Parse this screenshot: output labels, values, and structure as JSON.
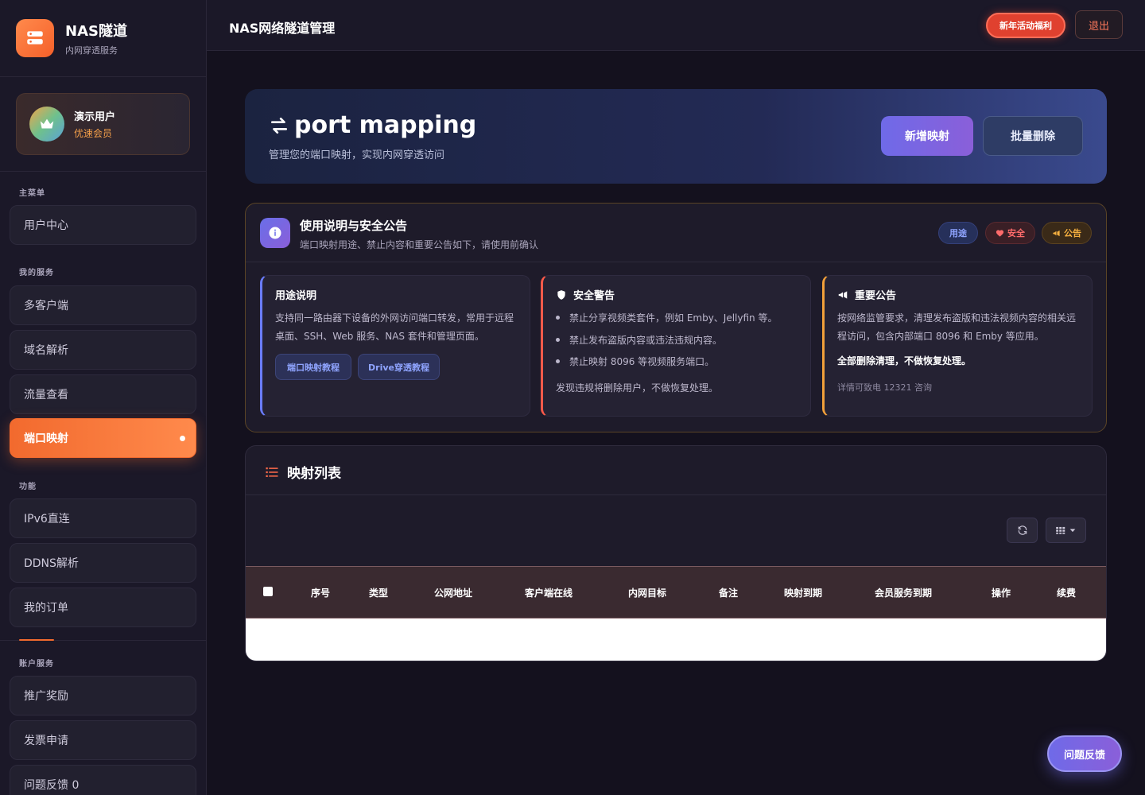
{
  "brand": {
    "title": "NAS隧道",
    "subtitle": "内网穿透服务"
  },
  "user": {
    "name": "演示用户",
    "level": "优速会员"
  },
  "sidebar": {
    "sections": {
      "main": "主菜单",
      "services": "我的服务",
      "features": "功能",
      "account": "账户服务"
    },
    "items": {
      "user_center": "用户中心",
      "multi_client": "多客户端",
      "domain": "域名解析",
      "traffic": "流量查看",
      "port_mapping": "端口映射",
      "ipv6": "IPv6直连",
      "ddns": "DDNS解析",
      "orders": "我的订单",
      "referral": "推广奖励",
      "invoice": "发票申请",
      "feedback": "问题反馈 0"
    }
  },
  "topbar": {
    "title": "NAS网络隧道管理",
    "promo": "新年活动福利",
    "logout": "退出"
  },
  "hero": {
    "title": "port mapping",
    "subtitle": "管理您的端口映射，实现内网穿透访问",
    "add_button": "新增映射",
    "delete_button": "批量删除"
  },
  "notice": {
    "title": "使用说明与安全公告",
    "subtitle": "端口映射用途、禁止内容和重要公告如下，请使用前确认",
    "tags": {
      "use": "用途",
      "safe": "安全",
      "announce": "公告"
    },
    "usage": {
      "title": "用途说明",
      "text": "支持同一路由器下设备的外网访问端口转发，常用于远程桌面、SSH、Web 服务、NAS 套件和管理页面。",
      "link1": "端口映射教程",
      "link2": "Drive穿透教程"
    },
    "security": {
      "title": "安全警告",
      "bullets": [
        "禁止分享视频类套件，例如 Emby、Jellyfin 等。",
        "禁止发布盗版内容或违法违规内容。",
        "禁止映射 8096 等视频服务端口。"
      ],
      "footer": "发现违规将删除用户，不做恢复处理。"
    },
    "announcement": {
      "title": "重要公告",
      "text": "按网络监管要求，清理发布盗版和违法视频内容的相关远程访问，包含内部端口 8096 和 Emby 等应用。",
      "strong": "全部删除清理，不做恢复处理。",
      "footer": "详情可致电 12321 咨询"
    }
  },
  "list": {
    "title": "映射列表",
    "columns": [
      "序号",
      "类型",
      "公网地址",
      "客户端在线",
      "内网目标",
      "备注",
      "映射到期",
      "会员服务到期",
      "操作",
      "续费"
    ]
  },
  "float": {
    "feedback": "问题反馈"
  },
  "colors": {
    "accent": "#f26a2e",
    "primary": "#6f6ae8",
    "danger": "#e0412f",
    "gold": "#f2a03a"
  }
}
